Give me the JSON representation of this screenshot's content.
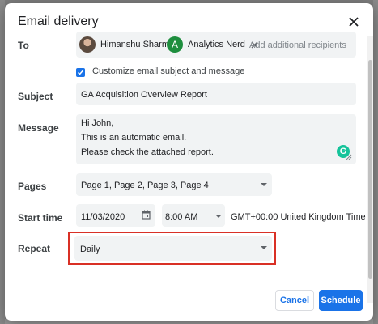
{
  "dialog": {
    "title": "Email delivery",
    "to": {
      "label": "To",
      "recipients": [
        {
          "name": "Himanshu Sharma",
          "avatar": "photo"
        },
        {
          "name": "Analytics Nerd",
          "avatar_letter": "A",
          "avatar_color": "#1e8e3e"
        }
      ],
      "placeholder": "Add additional recipients"
    },
    "customize": {
      "label": "Customize email subject and message",
      "checked": true
    },
    "subject": {
      "label": "Subject",
      "value": "GA Acquisition Overview Report"
    },
    "message": {
      "label": "Message",
      "lines": [
        "Hi John,",
        "This is an automatic email.",
        "Please check the attached report."
      ],
      "grammarly_letter": "G"
    },
    "pages": {
      "label": "Pages",
      "value": "Page 1, Page 2, Page 3, Page 4"
    },
    "start_time": {
      "label": "Start time",
      "date": "11/03/2020",
      "time": "8:00 AM",
      "timezone": "GMT+00:00 United Kingdom Time"
    },
    "repeat": {
      "label": "Repeat",
      "value": "Daily"
    },
    "buttons": {
      "cancel": "Cancel",
      "schedule": "Schedule"
    }
  },
  "colors": {
    "accent": "#1a73e8",
    "highlight": "#d93025",
    "field_bg": "#f1f3f4"
  },
  "icons": [
    "close-icon",
    "remove-recipient-icon",
    "checkbox-checked-icon",
    "calendar-icon",
    "dropdown-caret-icon",
    "grammarly-icon",
    "resize-handle-icon"
  ]
}
